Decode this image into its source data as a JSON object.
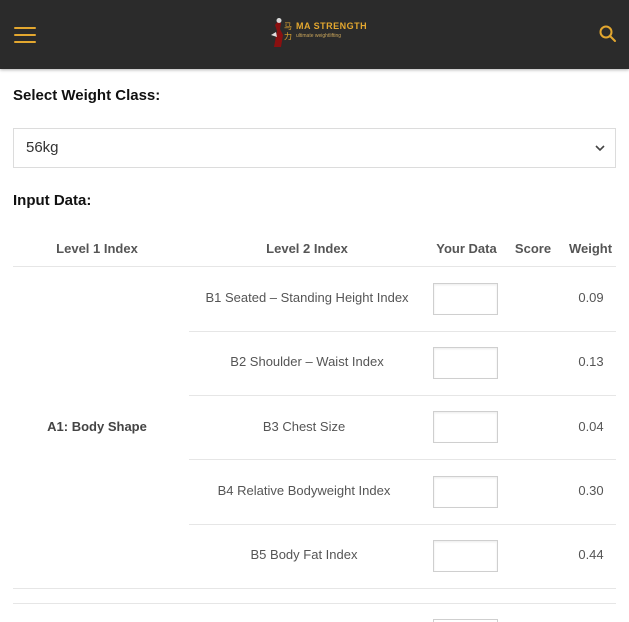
{
  "header": {
    "logo_text": "MA STRENGTH",
    "logo_tagline": "ultimate weightlifting",
    "logo_glyphs": "马力"
  },
  "weight_class": {
    "label": "Select Weight Class:",
    "selected": "56kg"
  },
  "input_data": {
    "label": "Input Data:"
  },
  "table": {
    "headers": [
      "Level 1 Index",
      "Level 2 Index",
      "Your Data",
      "Score",
      "Weight"
    ],
    "group": "A1: Body Shape",
    "rows": [
      {
        "level2": "B1 Seated – Standing Height Index",
        "your_data": "",
        "score": "",
        "weight": "0.09"
      },
      {
        "level2": "B2 Shoulder – Waist Index",
        "your_data": "",
        "score": "",
        "weight": "0.13"
      },
      {
        "level2": "B3 Chest Size",
        "your_data": "",
        "score": "",
        "weight": "0.04"
      },
      {
        "level2": "B4 Relative Bodyweight Index",
        "your_data": "",
        "score": "",
        "weight": "0.30"
      },
      {
        "level2": "B5 Body Fat Index",
        "your_data": "",
        "score": "",
        "weight": "0.44"
      }
    ]
  },
  "colors": {
    "header_bg": "#2b2b2b",
    "accent": "#e3a72f"
  },
  "icons": {
    "menu": "hamburger-icon",
    "search": "search-icon",
    "dropdown": "chevron-down-icon"
  }
}
